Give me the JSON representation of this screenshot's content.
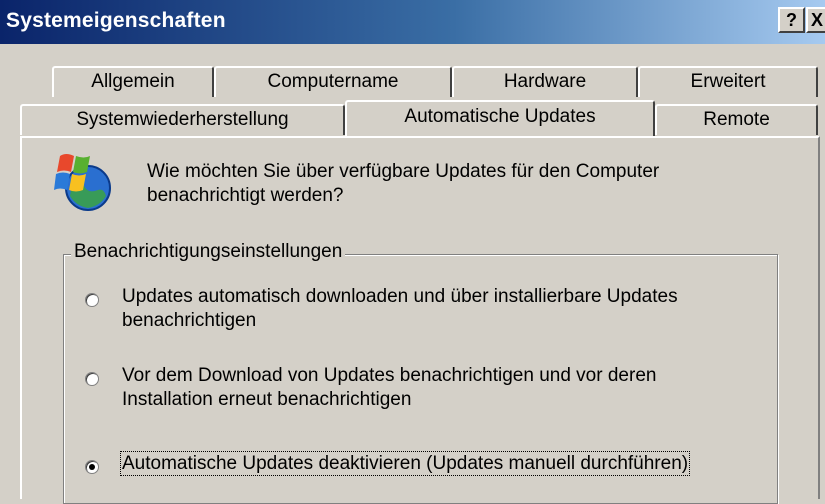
{
  "window": {
    "title": "Systemeigenschaften",
    "help_label": "?",
    "close_label": "X"
  },
  "tabs": {
    "row1": [
      "Allgemein",
      "Computername",
      "Hardware",
      "Erweitert"
    ],
    "row2": [
      "Systemwiederherstellung",
      "Automatische Updates",
      "Remote"
    ],
    "active": "Automatische Updates"
  },
  "content": {
    "icon": "windows-update-globe-icon",
    "question_line1": "Wie möchten Sie über verfügbare Updates für den Computer",
    "question_line2": "benachrichtigt werden?"
  },
  "notifications": {
    "legend": "Benachrichtigungseinstellungen",
    "options": [
      {
        "line1": "Updates automatisch downloaden und über installierbare Updates",
        "line2": "benachrichtigen",
        "selected": false
      },
      {
        "line1": "Vor dem Download von Updates benachrichtigen und vor deren",
        "line2": "Installation erneut benachrichtigen",
        "selected": false
      },
      {
        "line1": "Automatische Updates deaktivieren (Updates manuell durchführen)",
        "line2": "",
        "selected": true
      }
    ]
  }
}
